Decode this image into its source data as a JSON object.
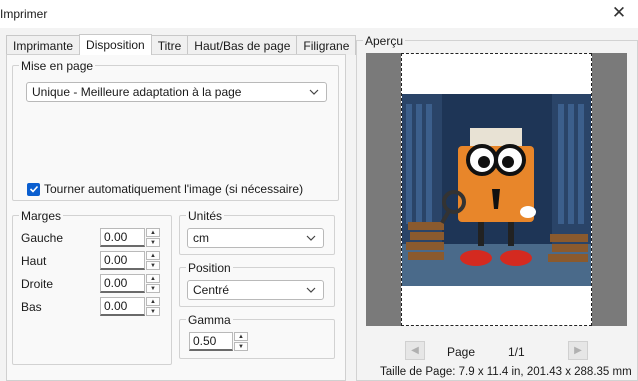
{
  "window": {
    "title": "Imprimer"
  },
  "tabs": [
    {
      "label": "Imprimante",
      "active": false
    },
    {
      "label": "Disposition",
      "active": true
    },
    {
      "label": "Titre",
      "active": false
    },
    {
      "label": "Haut/Bas de page",
      "active": false
    },
    {
      "label": "Filigrane",
      "active": false
    }
  ],
  "mise_en_page": {
    "legend": "Mise en page",
    "mode_value": "Unique - Meilleure adaptation à la page",
    "rotate_label": "Tourner automatiquement l'image (si nécessaire)",
    "rotate_checked": true
  },
  "marges": {
    "legend": "Marges",
    "rows": [
      {
        "label": "Gauche",
        "value": "0.00"
      },
      {
        "label": "Haut",
        "value": "0.00"
      },
      {
        "label": "Droite",
        "value": "0.00"
      },
      {
        "label": "Bas",
        "value": "0.00"
      }
    ]
  },
  "unites": {
    "legend": "Unités",
    "value": "cm"
  },
  "position": {
    "legend": "Position",
    "value": "Centré"
  },
  "gamma": {
    "legend": "Gamma",
    "value": "0.50"
  },
  "apercu": {
    "legend": "Aperçu",
    "page_label": "Page",
    "page_count": "1/1",
    "page_size": "Taille de Page: 7.9 x 11.4 in, 201.43 x 288.35 mm"
  },
  "colors": {
    "accent": "#0a5ecf",
    "preview_bg": "#7a7a7a"
  },
  "icons": [
    "close-icon",
    "chevron-down-icon",
    "spin-up-icon",
    "spin-down-icon",
    "prev-page-icon",
    "next-page-icon",
    "checkmark-icon"
  ]
}
